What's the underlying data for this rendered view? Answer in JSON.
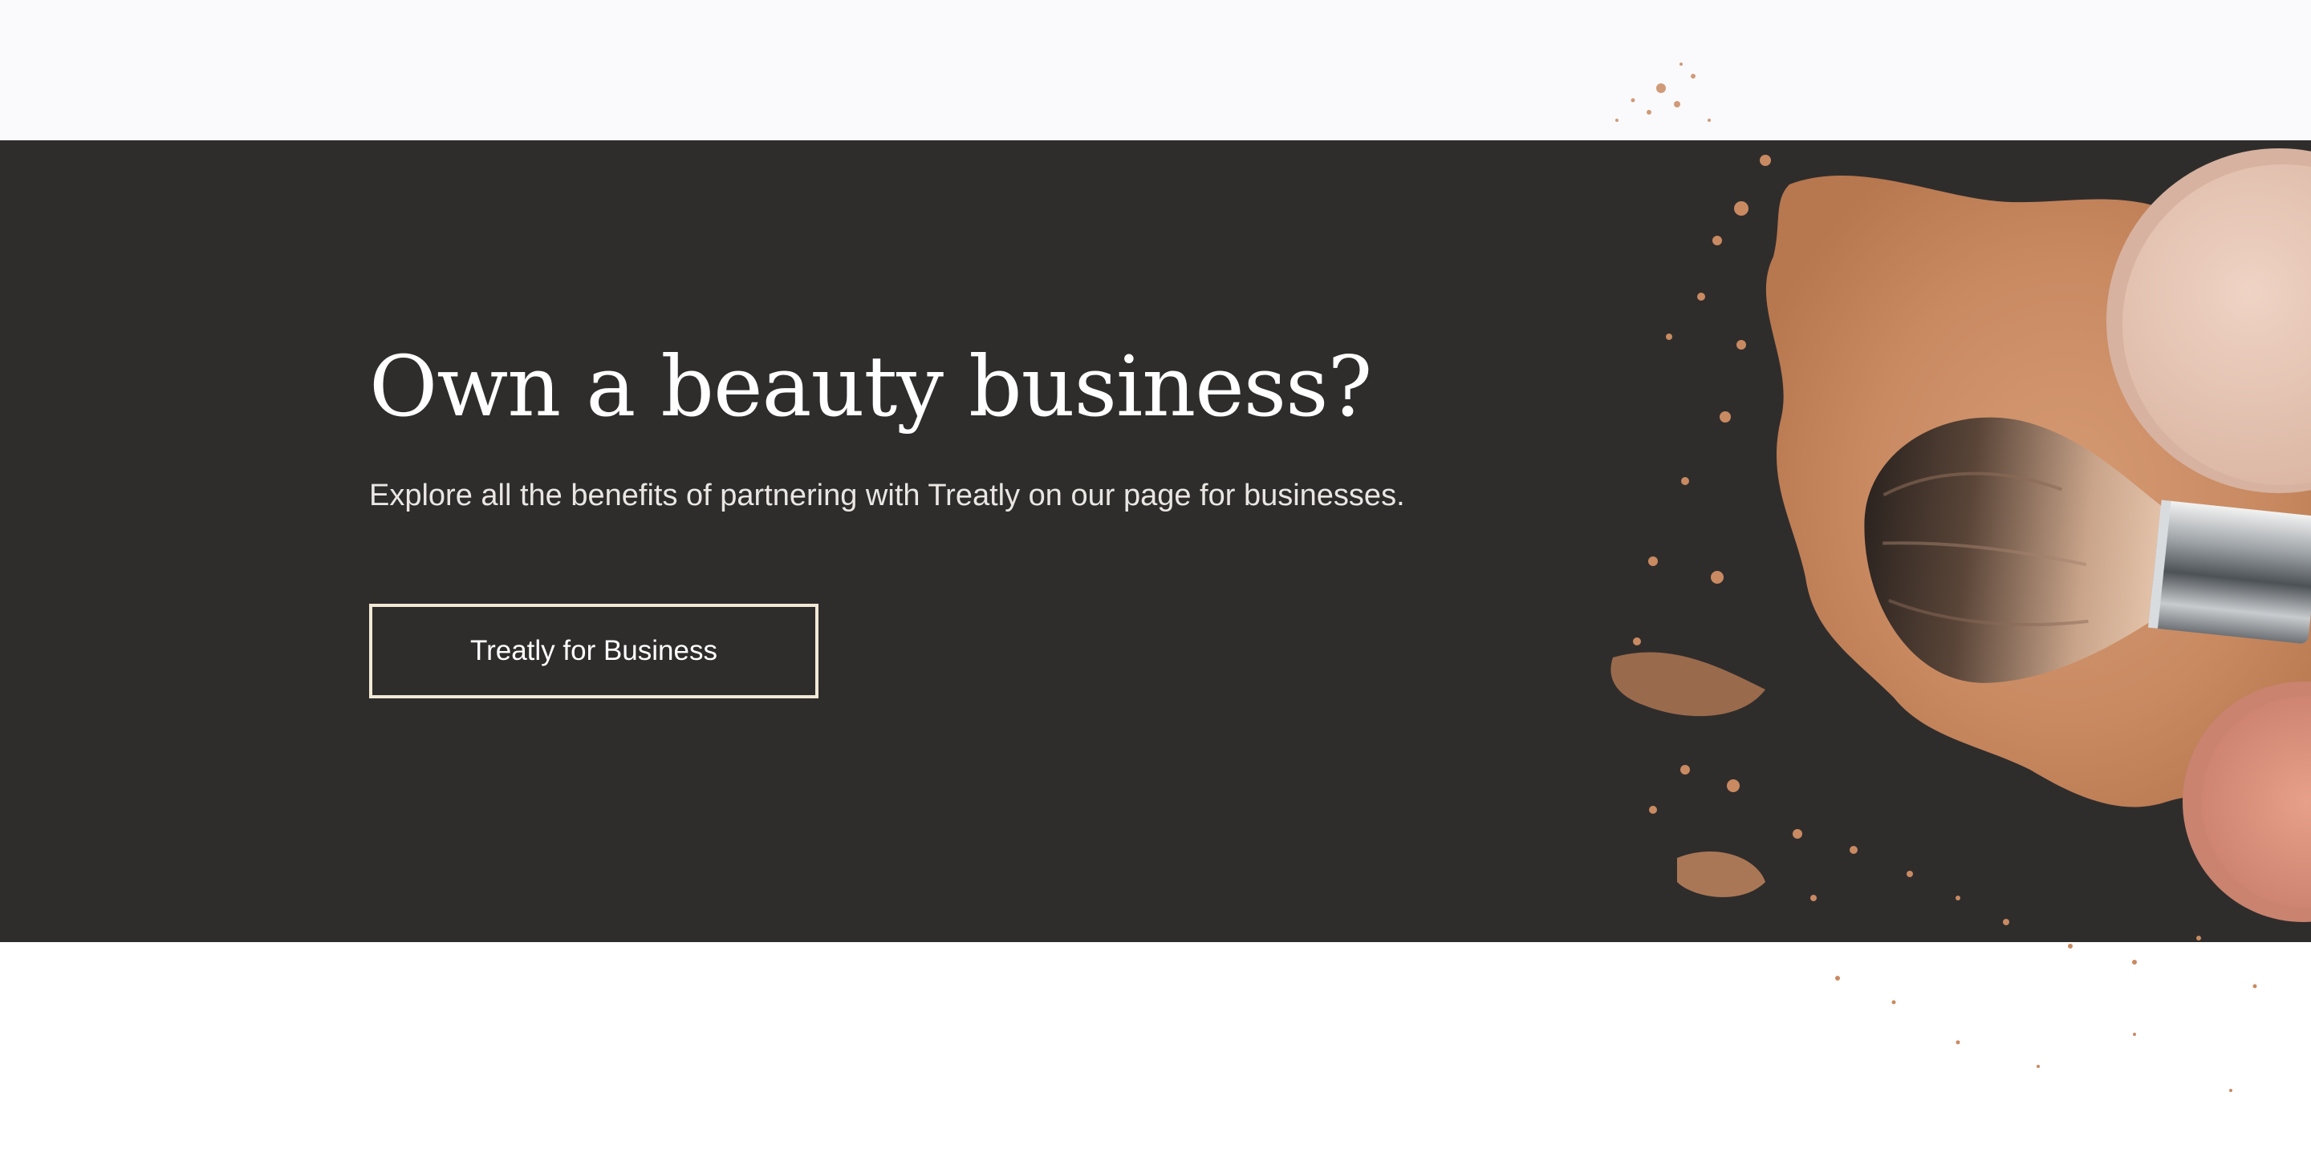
{
  "promo": {
    "headline": "Own a beauty business?",
    "subtext": "Explore all the benefits of partnering with Treatly on our page for businesses.",
    "cta_label": "Treatly for Business"
  },
  "colors": {
    "banner_background": "#2f2d2c",
    "top_strip": "#fafafc",
    "button_border": "#f1e9d6",
    "powder": "#c98f6b",
    "compact_light": "#e6c6b6",
    "blush": "#d98f7e"
  },
  "icons": {
    "artwork": "makeup-brush-powder-illustration"
  }
}
